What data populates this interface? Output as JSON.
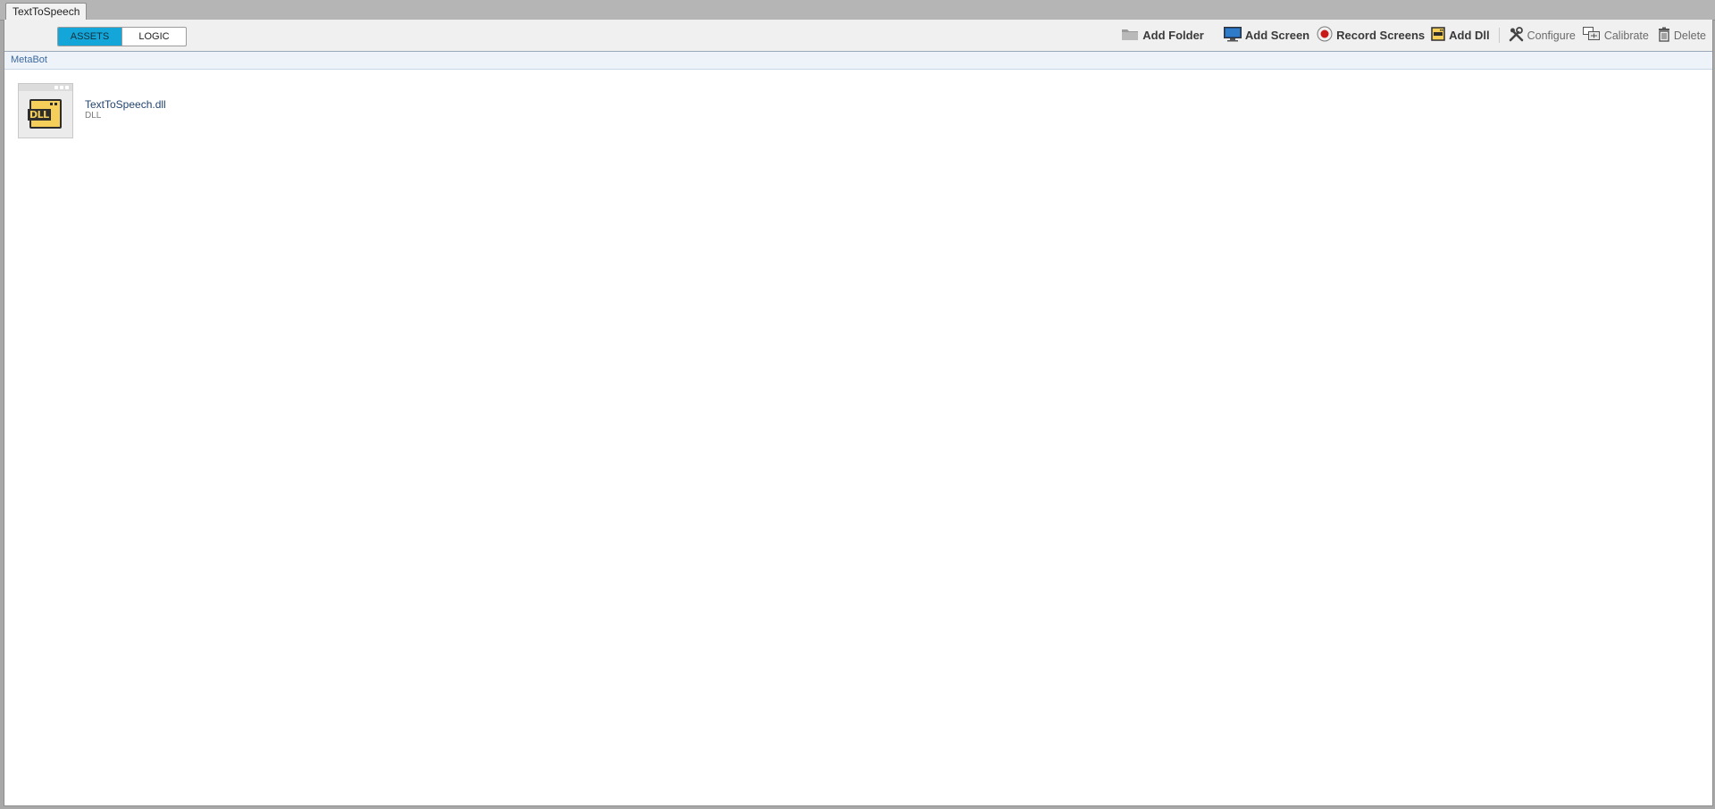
{
  "tabs": [
    {
      "label": "TextToSpeech"
    }
  ],
  "view_toggle": {
    "assets_label": "ASSETS",
    "logic_label": "LOGIC",
    "active": "ASSETS"
  },
  "toolbar": {
    "add_folder": "Add Folder",
    "add_screen": "Add Screen",
    "record_screens": "Record Screens",
    "add_dll": "Add Dll",
    "configure": "Configure",
    "calibrate": "Calibrate",
    "delete": "Delete"
  },
  "breadcrumb": {
    "label": "MetaBot"
  },
  "assets": [
    {
      "name": "TextToSpeech.dll",
      "type": "DLL",
      "icon": "dll-file-icon",
      "icon_text": "DLL"
    }
  ],
  "colors": {
    "accent": "#14a6d9",
    "dll_icon": "#f5cf59",
    "record": "#c81818"
  }
}
